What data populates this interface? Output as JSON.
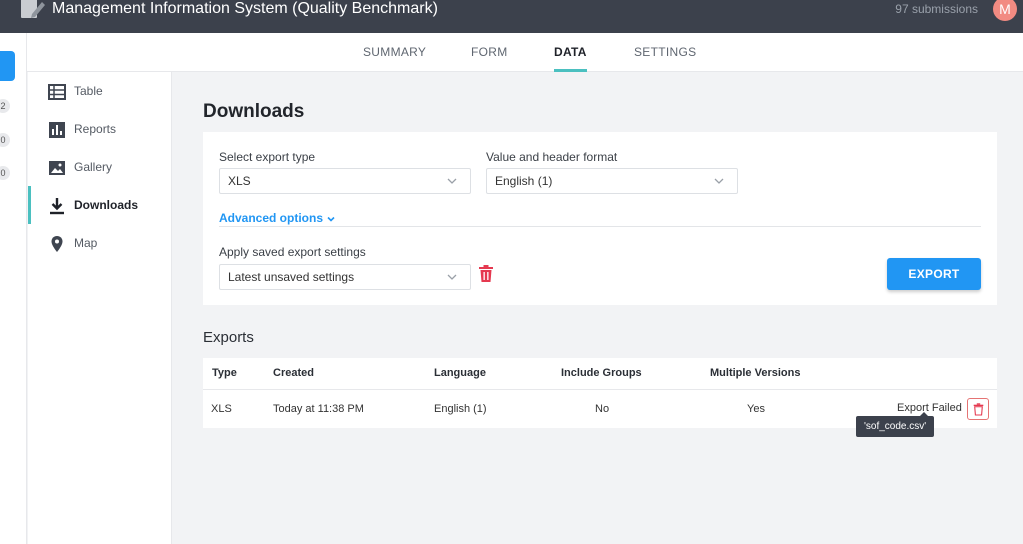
{
  "header": {
    "app_title": "Management Information System (Quality Benchmark)",
    "submissions": "97 submissions",
    "avatar_initial": "M"
  },
  "tabs": [
    {
      "label": "SUMMARY"
    },
    {
      "label": "FORM"
    },
    {
      "label": "DATA",
      "active": true
    },
    {
      "label": "SETTINGS"
    }
  ],
  "left_strip": {
    "badges": [
      "2",
      "0",
      "0"
    ]
  },
  "sidebar": {
    "items": [
      {
        "label": "Table",
        "icon": "table-icon"
      },
      {
        "label": "Reports",
        "icon": "bar-chart-icon"
      },
      {
        "label": "Gallery",
        "icon": "image-icon"
      },
      {
        "label": "Downloads",
        "icon": "download-icon",
        "active": true
      },
      {
        "label": "Map",
        "icon": "map-pin-icon"
      }
    ]
  },
  "main": {
    "title": "Downloads",
    "export_type_label": "Select export type",
    "export_type_value": "XLS",
    "format_label": "Value and header format",
    "format_value": "English (1)",
    "advanced_options": "Advanced options",
    "saved_settings_label": "Apply saved export settings",
    "saved_settings_value": "Latest unsaved settings",
    "export_button": "EXPORT"
  },
  "exports": {
    "title": "Exports",
    "columns": [
      "Type",
      "Created",
      "Language",
      "Include Groups",
      "Multiple Versions"
    ],
    "rows": [
      {
        "type": "XLS",
        "created": "Today at 11:38 PM",
        "language": "English (1)",
        "include_groups": "No",
        "multiple_versions": "Yes",
        "status": "Export Failed"
      }
    ],
    "tooltip": "'sof_code.csv'"
  },
  "colors": {
    "accent": "#2196f3",
    "active_tab": "#4bc0c0",
    "header_bg": "#3c414c",
    "danger": "#e53950"
  }
}
